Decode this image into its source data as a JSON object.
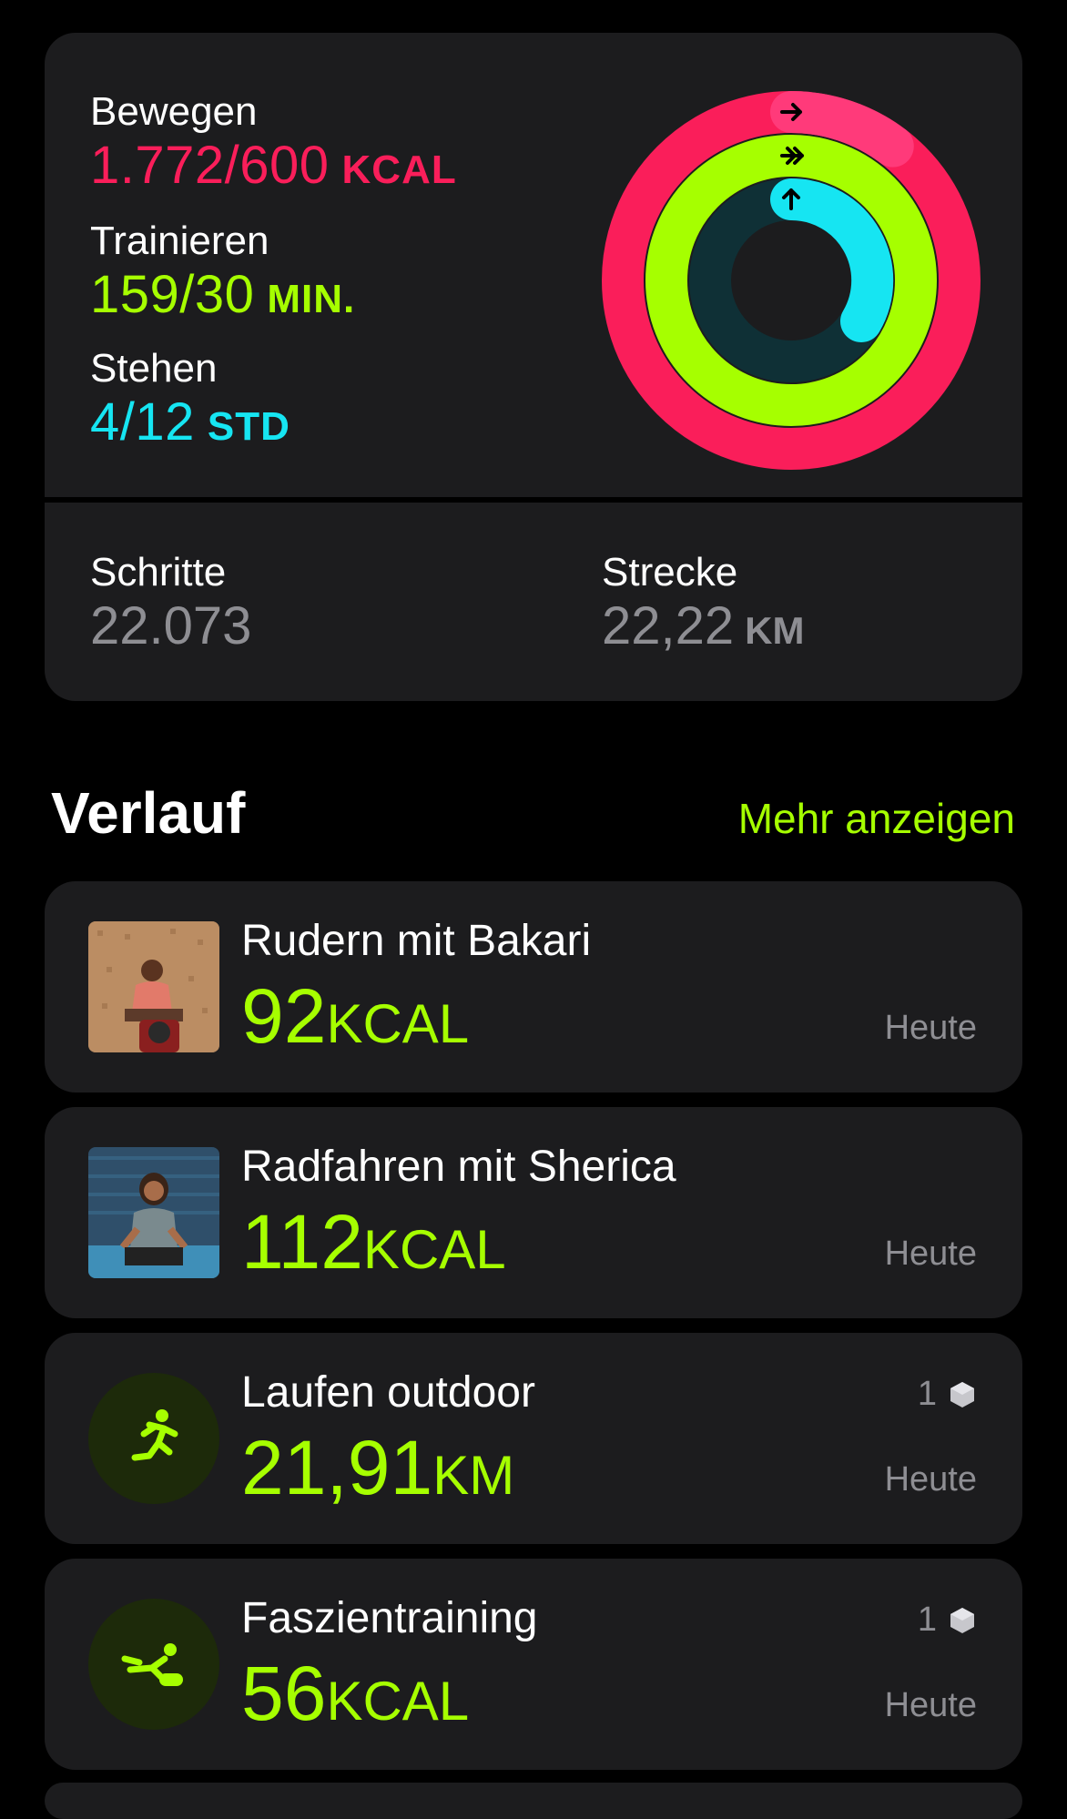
{
  "rings": {
    "move": {
      "label": "Bewegen",
      "value": "1.772/600",
      "unit": "KCAL",
      "color": "#fa1e5a",
      "progress": 2.95
    },
    "exercise": {
      "label": "Trainieren",
      "value": "159/30",
      "unit": "MIN.",
      "color": "#a6ff00",
      "progress": 5.3
    },
    "stand": {
      "label": "Stehen",
      "value": "4/12",
      "unit": "STD",
      "color": "#16e5f2",
      "progress": 0.33
    }
  },
  "stats": {
    "steps": {
      "label": "Schritte",
      "value": "22.073"
    },
    "distance": {
      "label": "Strecke",
      "value": "22,22",
      "unit": "KM"
    }
  },
  "history": {
    "title": "Verlauf",
    "more_label": "Mehr anzeigen",
    "items": [
      {
        "name": "Rudern mit Bakari",
        "value": "92",
        "unit": "KCAL",
        "date": "Heute"
      },
      {
        "name": "Radfahren mit Sherica",
        "value": "112",
        "unit": "KCAL",
        "date": "Heute"
      },
      {
        "name": "Laufen outdoor",
        "value": "21,91",
        "unit": "KM",
        "date": "Heute",
        "badge": "1",
        "icon": "running-icon"
      },
      {
        "name": "Faszientraining",
        "value": "56",
        "unit": "KCAL",
        "date": "Heute",
        "badge": "1",
        "icon": "stretching-icon"
      }
    ]
  }
}
